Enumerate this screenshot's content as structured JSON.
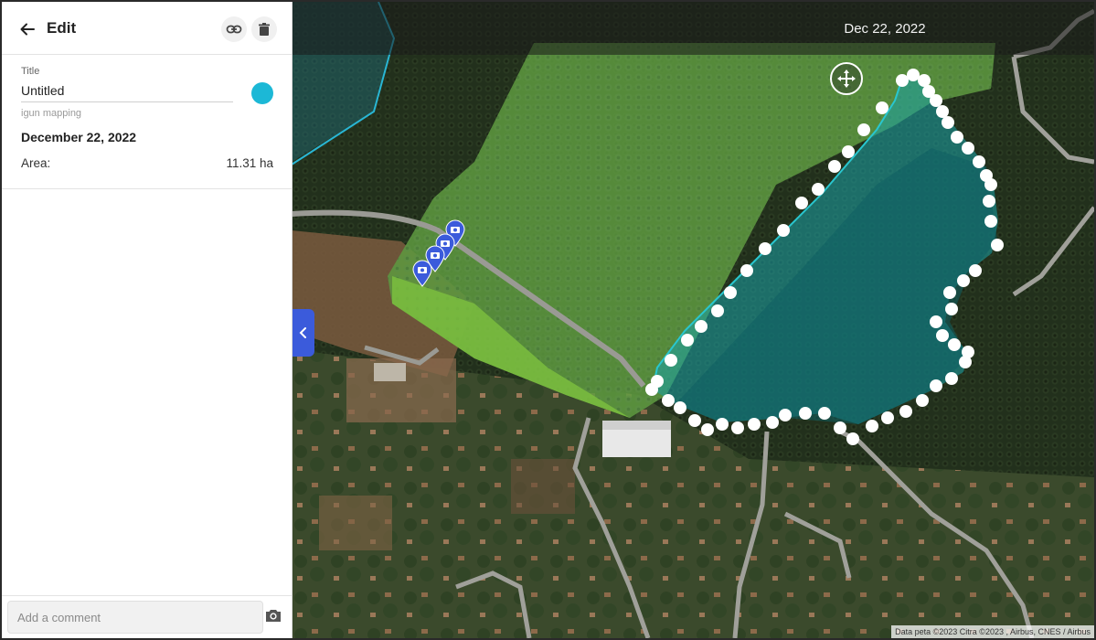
{
  "sidebar": {
    "header": {
      "title": "Edit",
      "back_icon": "arrow-left-icon",
      "link_icon": "link-icon",
      "delete_icon": "trash-icon"
    },
    "title_field": {
      "label": "Title",
      "value": "Untitled"
    },
    "color": "#1cb8d6",
    "project_name": "igun mapping",
    "date": "December 22, 2022",
    "area": {
      "label": "Area:",
      "value": "11.31 ha"
    },
    "comment": {
      "placeholder": "Add a comment",
      "camera_icon": "camera-icon"
    }
  },
  "map": {
    "date_banner": "Dec 22, 2022",
    "collapse_icon": "chevron-left-icon",
    "move_icon": "move-arrows-icon",
    "attribution": "Data peta ©2023 Citra ©2023 , Airbus, CNES / Airbus",
    "photo_markers": 4,
    "polygon_color": "#1aa3a8",
    "collapse_tab_color": "#3b5bdb"
  }
}
